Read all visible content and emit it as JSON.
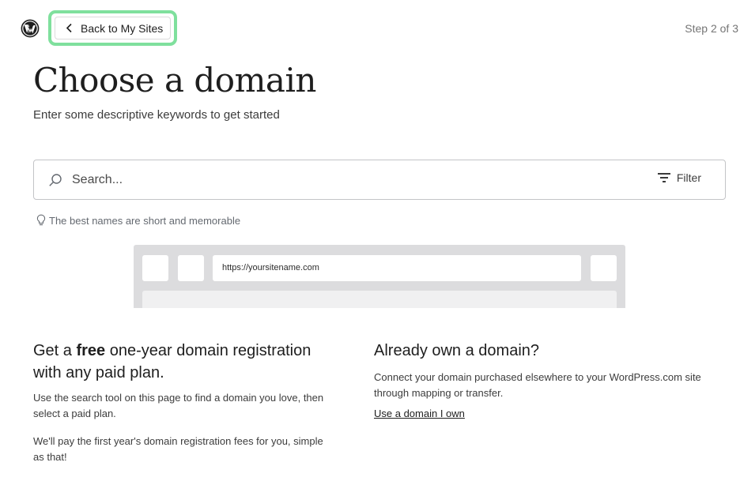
{
  "header": {
    "back_label": "Back to My Sites",
    "step_label": "Step 2 of 3"
  },
  "page": {
    "title": "Choose a domain",
    "subtitle": "Enter some descriptive keywords to get started"
  },
  "search": {
    "placeholder": "Search...",
    "value": "",
    "filter_label": "Filter",
    "tip": "The best names are short and memorable"
  },
  "preview": {
    "url": "https://yoursitename.com"
  },
  "free_domain": {
    "heading_prefix": "Get a ",
    "heading_bold": "free",
    "heading_suffix": " one-year domain registration with any paid plan.",
    "paragraph_1": "Use the search tool on this page to find a domain you love, then select a paid plan.",
    "paragraph_2": "We'll pay the first year's domain registration fees for you, simple as that!"
  },
  "own_domain": {
    "heading": "Already own a domain?",
    "paragraph": "Connect your domain purchased elsewhere to your WordPress.com site through mapping or transfer.",
    "link_label": "Use a domain I own"
  },
  "colors": {
    "highlight": "#7fe09d",
    "text": "#1e1e1e",
    "muted": "#757575",
    "browser_frame": "#dcdcde"
  },
  "icons": {
    "logo": "wordpress-logo-icon",
    "back": "chevron-left-icon",
    "search": "search-icon",
    "filter": "filter-icon",
    "tip": "lightbulb-icon"
  }
}
